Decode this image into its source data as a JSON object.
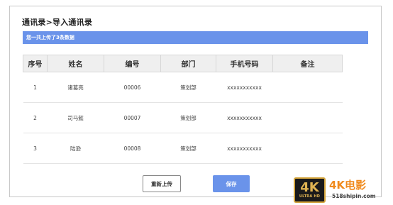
{
  "dialog": {
    "title": "通讯录>导入通讯录",
    "banner_text": "您一共上传了3条数据",
    "table": {
      "headers": [
        "序号",
        "姓名",
        "编号",
        "部门",
        "手机号码",
        "备注"
      ],
      "rows": [
        [
          "1",
          "诸葛亮",
          "00006",
          "策划部",
          "xxxxxxxxxxx",
          ""
        ],
        [
          "2",
          "司马懿",
          "00007",
          "策划部",
          "xxxxxxxxxxx",
          ""
        ],
        [
          "3",
          "陆逊",
          "00008",
          "策划部",
          "xxxxxxxxxxx",
          ""
        ]
      ]
    },
    "buttons": {
      "reupload_label": "重新上传",
      "save_label": "保存"
    }
  },
  "watermark": {
    "logo_big": "4K",
    "logo_small": "ULTRA HD",
    "brand": "4K电影",
    "url": "518shipin.com"
  },
  "colors": {
    "accent": "#6a93ea",
    "header_bg": "#efefef",
    "brand_orange": "#f08a1c",
    "logo_gold": "#e0b452"
  }
}
